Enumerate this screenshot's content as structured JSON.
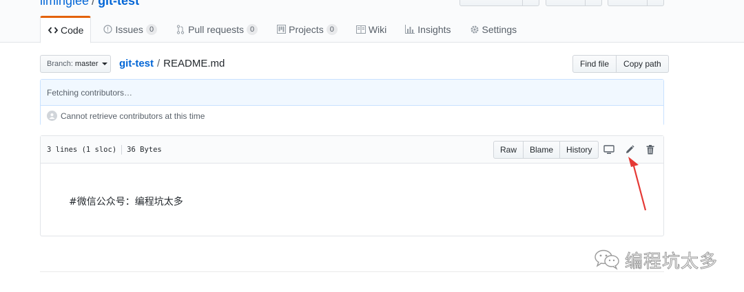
{
  "repo": {
    "owner": "liminglee",
    "name": "git-test"
  },
  "tabs": [
    {
      "label": "Code",
      "icon": "code-icon",
      "selected": true
    },
    {
      "label": "Issues",
      "icon": "issue-icon",
      "count": "0"
    },
    {
      "label": "Pull requests",
      "icon": "pull-request-icon",
      "count": "0"
    },
    {
      "label": "Projects",
      "icon": "project-icon",
      "count": "0"
    },
    {
      "label": "Wiki",
      "icon": "book-icon"
    },
    {
      "label": "Insights",
      "icon": "graph-icon"
    },
    {
      "label": "Settings",
      "icon": "gear-icon"
    }
  ],
  "branch": {
    "label": "Branch:",
    "value": "master"
  },
  "breadcrumb": {
    "root": "git-test",
    "separator": "/",
    "file": "README.md"
  },
  "actions": {
    "find_file": "Find file",
    "copy_path": "Copy path"
  },
  "contributors": {
    "fetching": "Fetching contributors…",
    "error": "Cannot retrieve contributors at this time"
  },
  "file": {
    "lines": "3 lines (1 sloc)",
    "size": "36 Bytes",
    "raw": "Raw",
    "blame": "Blame",
    "history": "History",
    "content": "#微信公众号：编程坑太多"
  },
  "watermark": {
    "text": "编程坑太多",
    "icon": "wechat-icon"
  },
  "colors": {
    "accent": "#e36209",
    "link": "#0366d6",
    "arrow": "#e53935"
  }
}
